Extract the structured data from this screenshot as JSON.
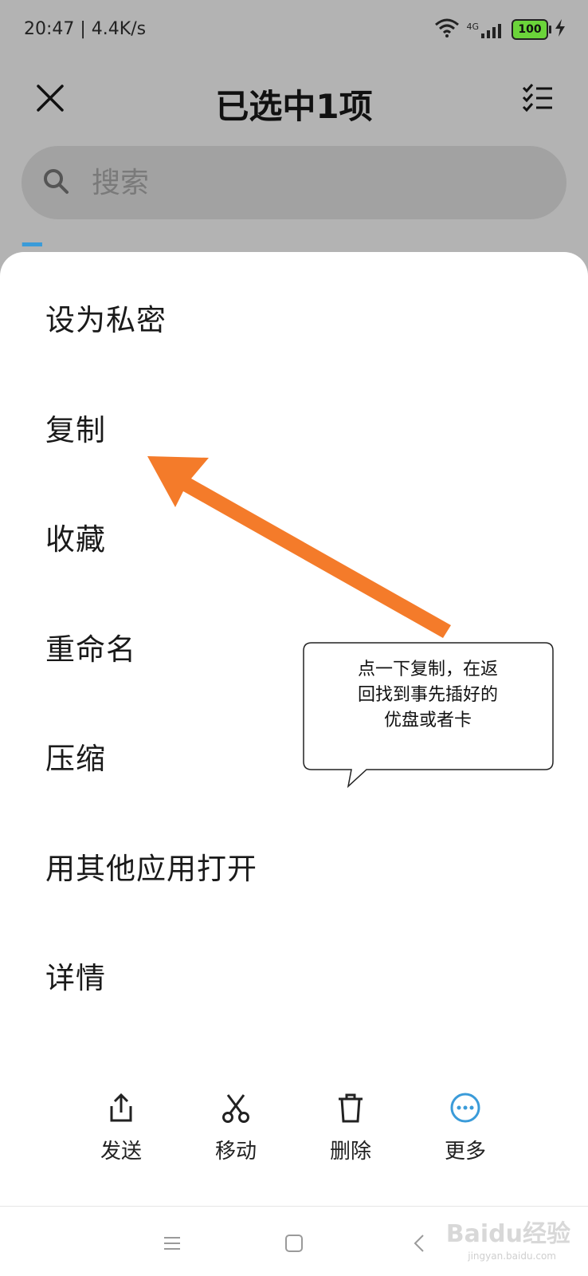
{
  "status_bar": {
    "time": "20:47 | 4.4K/s",
    "network": "4G",
    "battery": "100"
  },
  "header": {
    "title": "已选中1项"
  },
  "search": {
    "placeholder": "搜索"
  },
  "menu": {
    "items": [
      {
        "label": "设为私密"
      },
      {
        "label": "复制"
      },
      {
        "label": "收藏"
      },
      {
        "label": "重命名"
      },
      {
        "label": "压缩"
      },
      {
        "label": "用其他应用打开"
      },
      {
        "label": "详情"
      }
    ]
  },
  "annotation": {
    "line1": "点一下复制，在返",
    "line2": "回找到事先插好的",
    "line3": "优盘或者卡",
    "arrow_color": "#f47b2a"
  },
  "actions": [
    {
      "label": "发送",
      "icon": "share-icon"
    },
    {
      "label": "移动",
      "icon": "scissors-icon"
    },
    {
      "label": "删除",
      "icon": "trash-icon"
    },
    {
      "label": "更多",
      "icon": "more-icon"
    }
  ],
  "colors": {
    "accent": "#3a9bd9",
    "backdrop": "#b3b3b3"
  },
  "watermark": {
    "brand": "Baidu经验",
    "url": "jingyan.baidu.com"
  }
}
